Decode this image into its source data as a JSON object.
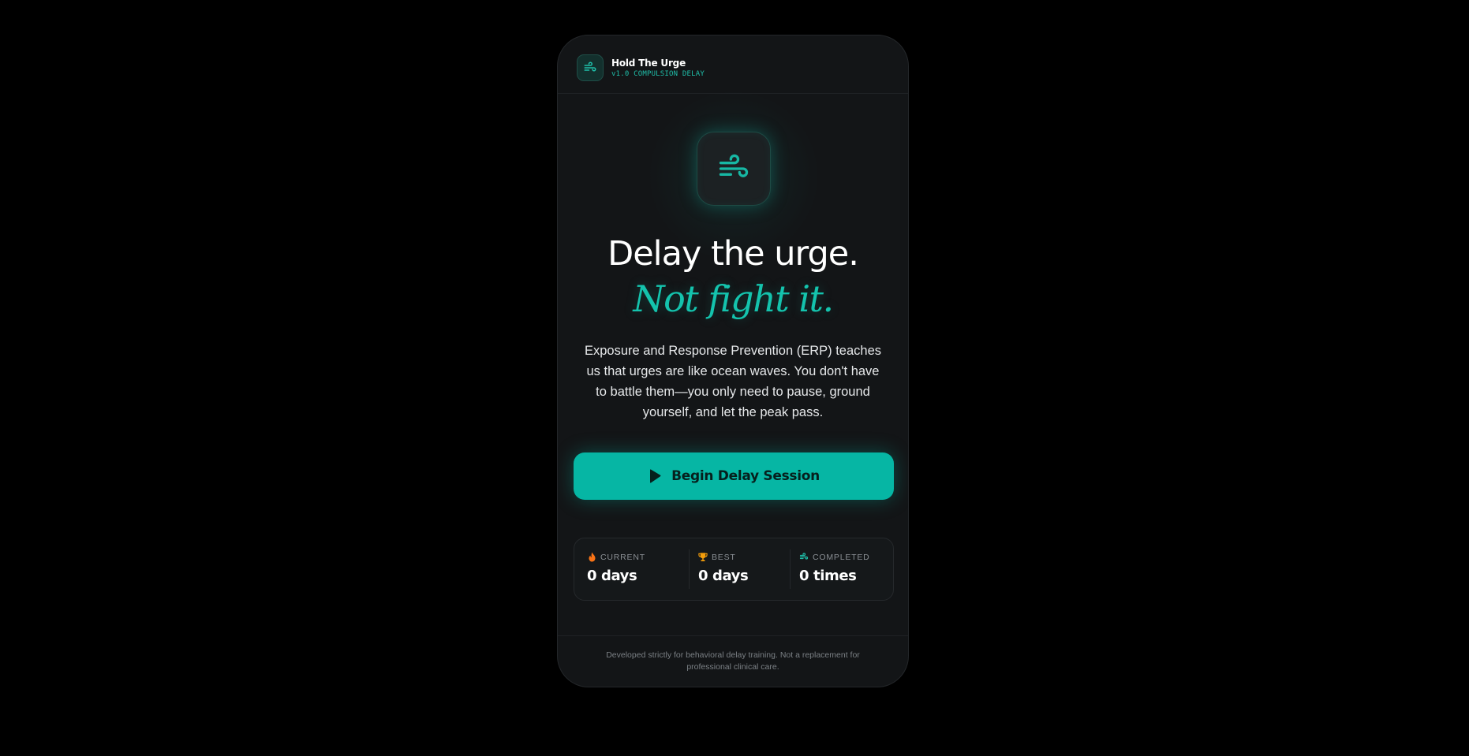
{
  "app": {
    "title": "Hold The Urge",
    "version": "v1.0 COMPULSION DELAY",
    "logo_icon": "wind-icon"
  },
  "hero": {
    "icon": "wind-icon",
    "headline_line1": "Delay the urge.",
    "headline_line2": "Not fight it.",
    "description": "Exposure and Response Prevention (ERP) teaches us that urges are like ocean waves. You don't have to battle them—you only need to pause, ground yourself, and let the peak pass."
  },
  "cta": {
    "label": "Begin Delay Session",
    "icon": "play-icon"
  },
  "stats": [
    {
      "icon": "flame-icon",
      "label": "CURRENT",
      "value": "0 days"
    },
    {
      "icon": "trophy-icon",
      "label": "BEST",
      "value": "0 days"
    },
    {
      "icon": "wind-icon",
      "label": "COMPLETED",
      "value": "0 times"
    }
  ],
  "footer": {
    "disclaimer": "Developed strictly for behavioral delay training. Not a replacement for professional clinical care."
  },
  "colors": {
    "background": "#000000",
    "card": "#131517",
    "accent": "#14c3ad",
    "button": "#06b6a4",
    "flame": "#f97316",
    "trophy": "#f59e0b"
  }
}
